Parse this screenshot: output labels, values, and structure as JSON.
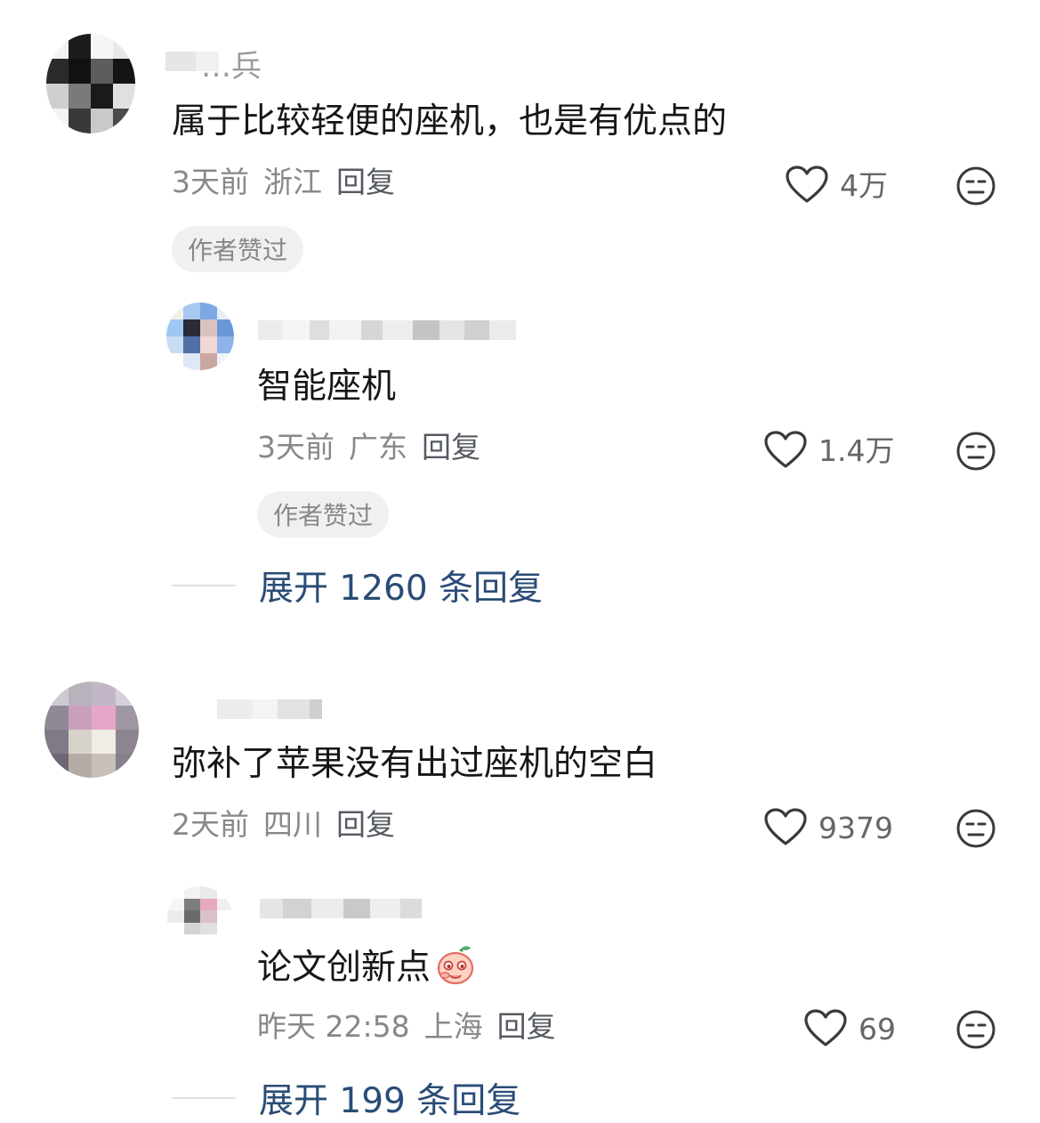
{
  "comments": [
    {
      "username": "…兵",
      "text": "属于比较轻便的座机，也是有优点的",
      "time": "3天前",
      "location": "浙江",
      "reply_label": "回复",
      "likes": "4万",
      "badge": "作者赞过",
      "replies": [
        {
          "text": "智能座机",
          "time": "3天前",
          "location": "广东",
          "reply_label": "回复",
          "likes": "1.4万",
          "badge": "作者赞过"
        }
      ],
      "expand_label": "展开 1260 条回复"
    },
    {
      "text": "弥补了苹果没有出过座机的空白",
      "time": "2天前",
      "location": "四川",
      "reply_label": "回复",
      "likes": "9379",
      "replies": [
        {
          "text": "论文创新点",
          "time": "昨天 22:58",
          "location": "上海",
          "reply_label": "回复",
          "likes": "69"
        }
      ],
      "expand_label": "展开 199 条回复"
    }
  ],
  "icons": {
    "like": "heart-outline-icon",
    "dislike": "neutral-face-icon",
    "sticker": "peach-sticker-icon"
  },
  "colors": {
    "expand_link": "#2a4c76",
    "meta_text": "#888888",
    "badge_bg": "#f0f0f1"
  }
}
